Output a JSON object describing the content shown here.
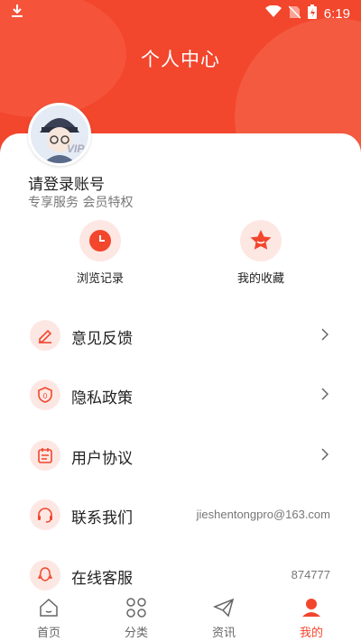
{
  "status_bar": {
    "time": "6:19"
  },
  "header": {
    "title": "个人中心"
  },
  "profile": {
    "vip": "VIP",
    "login_prompt": "请登录账号",
    "subtitle": "专享服务 会员特权"
  },
  "quick_actions": [
    {
      "label": "浏览记录",
      "icon": "clock-icon"
    },
    {
      "label": "我的收藏",
      "icon": "star-icon"
    }
  ],
  "menu": [
    {
      "label": "意见反馈",
      "icon": "edit-icon",
      "value": ""
    },
    {
      "label": "隐私政策",
      "icon": "shield-icon",
      "value": ""
    },
    {
      "label": "用户协议",
      "icon": "document-icon",
      "value": ""
    },
    {
      "label": "联系我们",
      "icon": "headset-icon",
      "value": "jieshentongpro@163.com"
    },
    {
      "label": "在线客服",
      "icon": "qq-icon",
      "value": "874777"
    }
  ],
  "tabs": [
    {
      "label": "首页",
      "icon": "home-icon",
      "active": false
    },
    {
      "label": "分类",
      "icon": "grid-icon",
      "active": false
    },
    {
      "label": "资讯",
      "icon": "paper-plane-icon",
      "active": false
    },
    {
      "label": "我的",
      "icon": "user-icon",
      "active": true
    }
  ],
  "colors": {
    "accent": "#f2462d",
    "icon_bg": "#fde7e3"
  }
}
